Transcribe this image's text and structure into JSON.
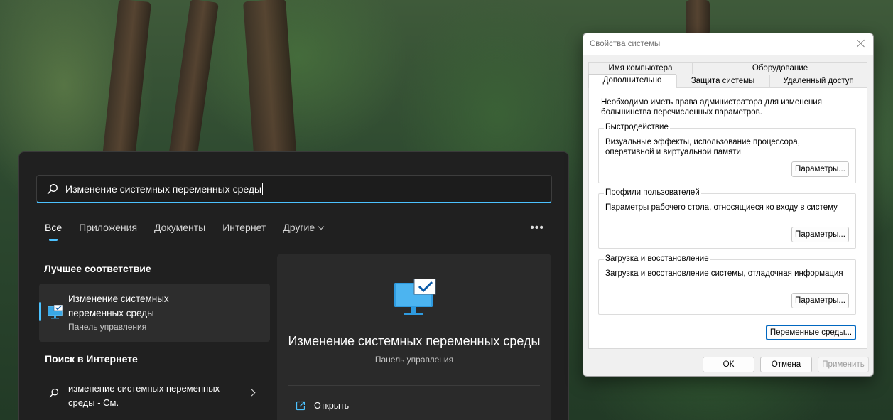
{
  "search_panel": {
    "query": "Изменение системных переменных среды",
    "filters": [
      {
        "label": "Все",
        "active": true
      },
      {
        "label": "Приложения",
        "active": false
      },
      {
        "label": "Документы",
        "active": false
      },
      {
        "label": "Интернет",
        "active": false
      },
      {
        "label": "Другие",
        "active": false
      }
    ],
    "more_label": "•••",
    "best_match_heading": "Лучшее соответствие",
    "best_match": {
      "title": "Изменение системных переменных среды",
      "subtitle": "Панель управления",
      "icon": "monitor-check-icon"
    },
    "web_heading": "Поиск в Интернете",
    "web_result": {
      "text": "изменение системных переменных среды - См.",
      "icon": "search-icon"
    },
    "detail": {
      "title": "Изменение системных переменных среды",
      "subtitle": "Панель управления",
      "actions": [
        {
          "label": "Открыть",
          "icon": "open-external-icon"
        }
      ]
    },
    "accent_color": "#4cc2ff"
  },
  "dialog": {
    "title": "Свойства системы",
    "tabs_row1": [
      "Имя компьютера",
      "Оборудование"
    ],
    "tabs_row2": [
      "Дополнительно",
      "Защита системы",
      "Удаленный доступ"
    ],
    "selected_tab": "Дополнительно",
    "intro": "Необходимо иметь права администратора для изменения большинства перечисленных параметров.",
    "groups": [
      {
        "legend": "Быстродействие",
        "description": "Визуальные эффекты, использование процессора, оперативной и виртуальной памяти",
        "button": "Параметры..."
      },
      {
        "legend": "Профили пользователей",
        "description": "Параметры рабочего стола, относящиеся ко входу в систему",
        "button": "Параметры..."
      },
      {
        "legend": "Загрузка и восстановление",
        "description": "Загрузка и восстановление системы, отладочная информация",
        "button": "Параметры..."
      }
    ],
    "env_button": "Переменные среды...",
    "ok": "ОК",
    "cancel": "Отмена",
    "apply": "Применить"
  }
}
